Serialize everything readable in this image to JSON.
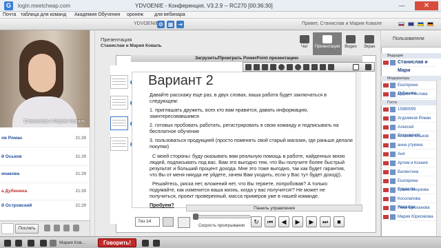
{
  "browser": {
    "url": "login.meetcheap.com",
    "title": "YDVOENIE - Конференция, V3.2.9 -- RC270 [00:36:30]",
    "bookmarks": [
      "Почта",
      "таблица для команд",
      "Академия Обучения",
      "оронеж",
      "для вебинара"
    ]
  },
  "app": {
    "name": "YDVOENIE",
    "greeting": "Привет, Станислав и Мария Ковале"
  },
  "left": {
    "video_name": "Станислав и Мария Коваль",
    "chat": [
      {
        "name": "ов Роман",
        "time": "21:29",
        "red": false
      },
      {
        "name": "й Оськов",
        "time": "21:29",
        "red": false
      },
      {
        "name": "инакова",
        "time": "21:29",
        "red": false
      },
      {
        "name": "а Дубинина",
        "time": "21:29",
        "red": true
      },
      {
        "name": "й Островский",
        "time": "21:29",
        "red": false
      }
    ],
    "send_label": "Послать"
  },
  "center": {
    "section": "Презентация",
    "presenter": "Станислав и Мария Коваль",
    "tabs": [
      {
        "label": "Чат",
        "active": false
      },
      {
        "label": "Презентация",
        "active": true
      },
      {
        "label": "Видео",
        "active": false
      },
      {
        "label": "Экран",
        "active": false
      }
    ],
    "upload_label": "Загрузить/Проиграть PowerPoint презентацию",
    "thumb_numbers": [
      "6",
      "7",
      "8",
      "9"
    ],
    "slide": {
      "title": "Вариант 2",
      "p1": "Давайте расскажу еще раз, в двух словах, ваша работа будет заключаться в следующем:",
      "p2": "1. приглашать дружить, всех кто вам нравится, давать информацию, заинтересовавшимся",
      "p3": "2. готовых пробовать работать, регистрировать в свою команду и подписывать на бесплатное обучение",
      "p4": "3. пользоваться продукцией (просто поменять свой старый магазин, где раньше делали покупки)",
      "p5": "С моей стороны: буду оказывать вам реальную помощь в работе, найденных мною людей, подписывать под вас. Вам это выгодно тем, что Вы получите более быстрый результат и больший процент дохода. Мне это тоже выгодно, так как будет гарантия, что Вы от меня никуда не уйдете, зачем Вам уходить, если у Вас тут будет доход)).",
      "p6": "Решайтесь, риска нет, вложений нет, что Вы теряете, попробовав? А только подумайте, как изменится ваша жизнь, когда у вас получится!? Не может не получиться, проект проверенный, масса примеров уже в нашей команде.",
      "p7": "Пробуем?"
    },
    "control_label": "Панель управления",
    "page": "7из 14",
    "speed_label": "Скорость проигрывания"
  },
  "right": {
    "header": "Пользователи",
    "sections": {
      "leading": "Ведущие",
      "moderators": "Модераторы",
      "guests": "Гости"
    },
    "leading": [
      "Станислав и Мари"
    ],
    "moderators": [
      "Екатерина Дубинина",
      "Мария Рослова"
    ],
    "guests": [
      "15989095",
      "Агуриянов Роман",
      "Алексей Островский",
      "Алексей Оськов",
      "анна утукина",
      "Аня",
      "Артем и Ксения",
      "Валентина",
      "Екатерина Кудакова",
      "Елена Энзукова",
      "Косолапова Надежда",
      "Лена Брюханова",
      "Мария Юрисикова"
    ]
  },
  "bottom": {
    "who": "Мария Ков...",
    "talk_label": "Говорить!"
  }
}
